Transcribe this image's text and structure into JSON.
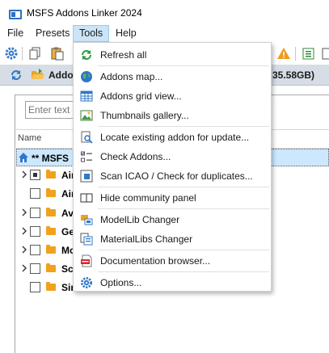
{
  "window": {
    "title": "MSFS Addons Linker 2024"
  },
  "menubar": {
    "items": [
      "File",
      "Presets",
      "Tools",
      "Help"
    ]
  },
  "panel": {
    "title": "Addo",
    "size": "35.58GB)"
  },
  "filter": {
    "placeholder": "Enter text t"
  },
  "columns": {
    "name": "Name"
  },
  "tree": {
    "root": {
      "label": "** MSFS"
    },
    "rows": [
      {
        "label": "Air",
        "state": "partial"
      },
      {
        "label": "Air",
        "state": "unchecked"
      },
      {
        "label": "Av",
        "state": "unchecked"
      },
      {
        "label": "Ge",
        "state": "unchecked"
      },
      {
        "label": "Mo",
        "state": "unchecked"
      },
      {
        "label": "Sc",
        "state": "unchecked"
      },
      {
        "label": "Sin",
        "state": "unchecked"
      }
    ]
  },
  "tools_menu": {
    "items": [
      {
        "label": "Refresh all",
        "icon": "refresh-icon"
      },
      {
        "label": "Addons map...",
        "icon": "globe-icon"
      },
      {
        "label": "Addons grid view...",
        "icon": "grid-icon"
      },
      {
        "label": "Thumbnails gallery...",
        "icon": "image-icon"
      },
      {
        "label": "Locate existing addon for update...",
        "icon": "locate-doc-icon"
      },
      {
        "label": "Check Addons...",
        "icon": "checklist-icon"
      },
      {
        "label": "Scan ICAO / Check for duplicates...",
        "icon": "scan-icon"
      },
      {
        "label": "Hide community panel",
        "icon": "panel-icon"
      },
      {
        "label": "ModelLib Changer",
        "icon": "modellib-icon"
      },
      {
        "label": "MaterialLibs Changer",
        "icon": "materiallib-icon"
      },
      {
        "label": "Documentation browser...",
        "icon": "pdf-icon"
      },
      {
        "label": "Options...",
        "icon": "gear-icon"
      }
    ]
  },
  "colors": {
    "accent": "#0078d7",
    "menu_active": "#cce4f7",
    "panel_bar": "#d7dde6",
    "folder": "#f0a21d",
    "selection": "#cce8ff"
  }
}
